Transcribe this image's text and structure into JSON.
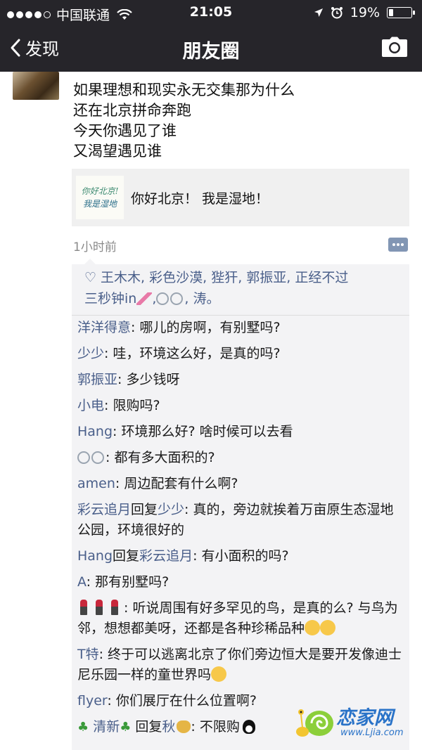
{
  "status_bar": {
    "carrier": "中国联通",
    "time": "21:05",
    "battery": "19%",
    "battery_level": 0.19,
    "signal_bars_filled": 4,
    "signal_bars_total": 5
  },
  "nav": {
    "back_label": "发现",
    "title": "朋友圈"
  },
  "post": {
    "lines": [
      "如果理想和现实永无交集那为什么",
      "还在北京拼命奔跑",
      "今天你遇见了谁",
      "又渴望遇见谁"
    ],
    "link": {
      "thumb_line1": "你好北京!",
      "thumb_line2": "我是湿地",
      "title": "你好北京！ 我是湿地！"
    },
    "time_ago": "1小时前"
  },
  "likes": {
    "names_part1": "王木木, 彩色沙漠, 狴犴, 郭振亚, 正经不过",
    "names_part2": "三秒钟in",
    "names_part3": ",",
    "names_part4": ", 涛。"
  },
  "comments": [
    {
      "name": "洋洋得意",
      "text": ": 哪儿的房啊，有别墅吗?"
    },
    {
      "name": "少少",
      "text": ": 哇，环境这么好，是真的吗?"
    },
    {
      "name": "郭振亚",
      "text": ":  多少钱呀"
    },
    {
      "name": "小电",
      "text": ":  限购吗?"
    },
    {
      "name": "Hang",
      "text": ": 环境那么好? 啥时候可以去看"
    },
    {
      "name": "",
      "text": ": 都有多大面积的?"
    },
    {
      "name": "amen",
      "text": ": 周边配套有什么啊?"
    },
    {
      "name": "彩云追月",
      "verb": "回复",
      "target": "少少",
      "text": ": 真的，旁边就挨着万亩原生态湿地公园，环境很好的"
    },
    {
      "name": "Hang",
      "verb": "回复",
      "target": "彩云追月",
      "text": ": 有小面积的吗?"
    },
    {
      "name": "A",
      "text": ": 那有别墅吗?"
    },
    {
      "name": "",
      "text": ": 听说周围有好多罕见的鸟，是真的么? 与鸟为邻，想想都美呀，还都是各种珍稀品种"
    },
    {
      "name": "T特",
      "text": ": 终于可以逃离北京了你们旁边恒大是要开发像迪士尼乐园一样的童世界吗"
    },
    {
      "name": "flyer",
      "text": ": 你们展厅在什么位置啊?"
    },
    {
      "name": "清新",
      "verb": "回复",
      "target": "秋",
      "text": ": 不限购"
    }
  ],
  "watermark": {
    "brand": "恋家网",
    "url": "www.Ljia.com"
  }
}
